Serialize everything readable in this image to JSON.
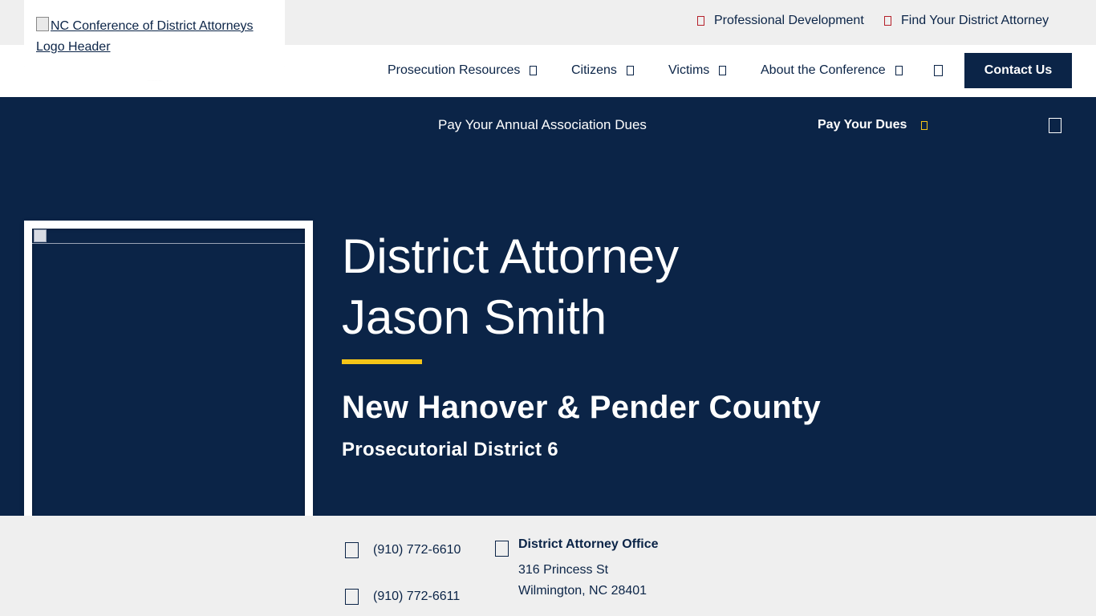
{
  "utility_nav": {
    "professional_development": "Professional Development",
    "find_da": "Find Your District Attorney"
  },
  "logo": {
    "alt_text": "NC Conference of District Attorneys Logo Header"
  },
  "main_nav": {
    "items": [
      {
        "label": "Prosecution Resources"
      },
      {
        "label": "Citizens"
      },
      {
        "label": "Victims"
      },
      {
        "label": "About the Conference"
      }
    ],
    "contact_label": "Contact Us"
  },
  "banner": {
    "text": "Pay Your Annual Association Dues",
    "link_label": "Pay Your Dues"
  },
  "profile": {
    "title_line1": "District Attorney",
    "title_line2": "Jason Smith",
    "county": "New Hanover & Pender County",
    "district": "Prosecutorial District 6"
  },
  "contact": {
    "phone": "(910) 772-6610",
    "fax": "(910) 772-6611",
    "office_title": "District Attorney Office",
    "street": "316 Princess St",
    "city": "Wilmington, NC 28401"
  },
  "colors": {
    "navy": "#0b2447",
    "accent_yellow": "#f5c518",
    "utility_red": "#b5202a",
    "light_gray": "#efefef"
  }
}
